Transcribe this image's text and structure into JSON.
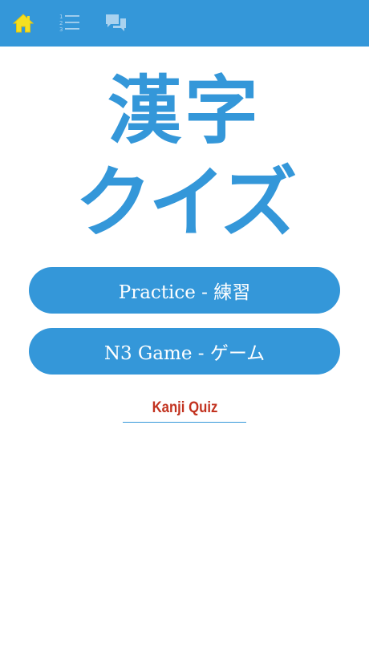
{
  "colors": {
    "accent": "#3497d9",
    "home_icon": "#f5e021",
    "link": "#c2321f",
    "background": "#ffffff"
  },
  "toolbar": {
    "items": [
      {
        "icon": "home-icon"
      },
      {
        "icon": "numbered-list-icon"
      },
      {
        "icon": "chat-bubbles-icon"
      }
    ],
    "list_numbers": [
      "1",
      "2",
      "3"
    ]
  },
  "hero": {
    "line1": "漢字",
    "line2": "クイズ"
  },
  "buttons": {
    "practice": "Practice - 練習",
    "game": "N3 Game - ゲーム"
  },
  "footer_link": {
    "label": "Kanji Quiz"
  }
}
